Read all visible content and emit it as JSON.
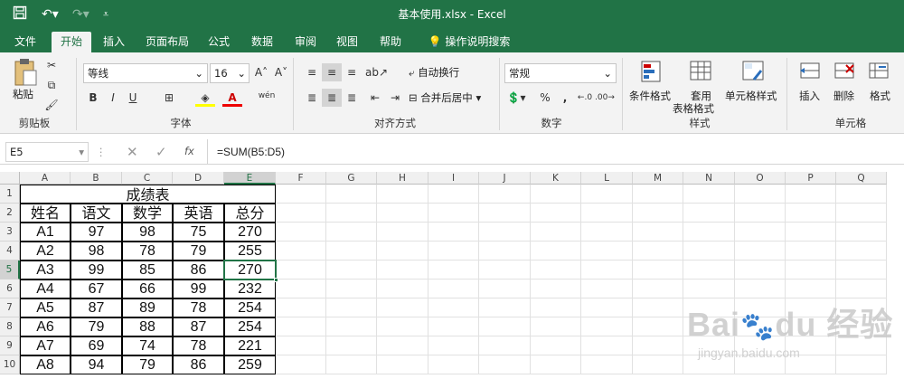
{
  "window": {
    "title": "基本使用.xlsx  -  Excel"
  },
  "tabs": [
    "文件",
    "开始",
    "插入",
    "页面布局",
    "公式",
    "数据",
    "审阅",
    "视图",
    "帮助"
  ],
  "tell_me": "操作说明搜索",
  "ribbon": {
    "paste": "粘贴",
    "clipboard": "剪贴板",
    "font_name": "等线",
    "font_size": "16",
    "font_group": "字体",
    "wrap_text": "自动换行",
    "merge_center": "合并后居中",
    "align_group": "对齐方式",
    "number_format": "常规",
    "number_group": "数字",
    "cond_format": "条件格式",
    "table_format_1": "套用",
    "table_format_2": "表格格式",
    "cell_styles": "单元格样式",
    "styles_group": "样式",
    "insert": "插入",
    "delete": "删除",
    "format": "格式",
    "cells_group": "单元格",
    "bold": "B",
    "italic": "I",
    "underline": "U",
    "font_color": "A",
    "wen": "wén",
    "percent": "%",
    "comma": ","
  },
  "formula_bar": {
    "name_box": "E5",
    "fx": "fx",
    "formula": "=SUM(B5:D5)"
  },
  "columns": [
    "A",
    "B",
    "C",
    "D",
    "E",
    "F",
    "G",
    "H",
    "I",
    "J",
    "K",
    "L",
    "M",
    "N",
    "O",
    "P",
    "Q"
  ],
  "rows": [
    "1",
    "2",
    "3",
    "4",
    "5",
    "6",
    "7",
    "8",
    "9",
    "10"
  ],
  "sheet": {
    "title": "成绩表",
    "headers": [
      "姓名",
      "语文",
      "数学",
      "英语",
      "总分"
    ],
    "data": [
      [
        "A1",
        "97",
        "98",
        "75",
        "270"
      ],
      [
        "A2",
        "98",
        "78",
        "79",
        "255"
      ],
      [
        "A3",
        "99",
        "85",
        "86",
        "270"
      ],
      [
        "A4",
        "67",
        "66",
        "99",
        "232"
      ],
      [
        "A5",
        "87",
        "89",
        "78",
        "254"
      ],
      [
        "A6",
        "79",
        "88",
        "87",
        "254"
      ],
      [
        "A7",
        "69",
        "74",
        "78",
        "221"
      ],
      [
        "A8",
        "94",
        "79",
        "86",
        "259"
      ]
    ]
  },
  "watermark": "Baidu经验 jingyan.baidu.com",
  "colors": {
    "excel_green": "#217346",
    "selection": "#217346"
  }
}
